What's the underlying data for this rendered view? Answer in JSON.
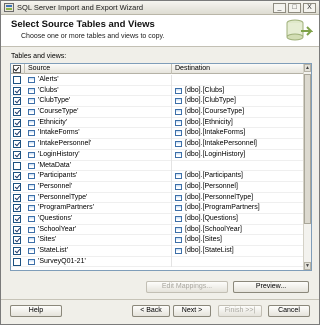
{
  "window": {
    "title": "SQL Server Import and Export Wizard",
    "minimize": "_",
    "maximize": "□",
    "close": "X"
  },
  "header": {
    "title": "Select Source Tables and Views",
    "subtitle": "Choose one or more tables and views to copy."
  },
  "grid": {
    "label": "Tables and views:",
    "columns": {
      "source": "Source",
      "destination": "Destination"
    },
    "header_checked": true,
    "rows": [
      {
        "checked": false,
        "source": "'Alerts'",
        "destination": ""
      },
      {
        "checked": true,
        "source": "'Clubs'",
        "destination": "[dbo].[Clubs]"
      },
      {
        "checked": true,
        "source": "'ClubType'",
        "destination": "[dbo].[ClubType]"
      },
      {
        "checked": true,
        "source": "'CourseType'",
        "destination": "[dbo].[CourseType]"
      },
      {
        "checked": true,
        "source": "'Ethnicity'",
        "destination": "[dbo].[Ethnicity]"
      },
      {
        "checked": true,
        "source": "'IntakeForms'",
        "destination": "[dbo].[IntakeForms]"
      },
      {
        "checked": true,
        "source": "'IntakePersonnel'",
        "destination": "[dbo].[IntakePersonnel]"
      },
      {
        "checked": true,
        "source": "'LoginHistory'",
        "destination": "[dbo].[LoginHistory]"
      },
      {
        "checked": false,
        "source": "'MetaData'",
        "destination": ""
      },
      {
        "checked": true,
        "source": "'Participants'",
        "destination": "[dbo].[Participants]"
      },
      {
        "checked": true,
        "source": "'Personnel'",
        "destination": "[dbo].[Personnel]"
      },
      {
        "checked": true,
        "source": "'PersonnelType'",
        "destination": "[dbo].[PersonnelType]"
      },
      {
        "checked": true,
        "source": "'ProgramPartners'",
        "destination": "[dbo].[ProgramPartners]"
      },
      {
        "checked": true,
        "source": "'Questions'",
        "destination": "[dbo].[Questions]"
      },
      {
        "checked": true,
        "source": "'SchoolYear'",
        "destination": "[dbo].[SchoolYear]"
      },
      {
        "checked": true,
        "source": "'Sites'",
        "destination": "[dbo].[Sites]"
      },
      {
        "checked": true,
        "source": "'StateList'",
        "destination": "[dbo].[StateList]"
      },
      {
        "checked": false,
        "source": "'SurveyQ01-21'",
        "destination": ""
      }
    ]
  },
  "buttons": {
    "edit_mappings": "Edit Mappings...",
    "preview": "Preview...",
    "help": "Help",
    "back": "< Back",
    "next": "Next >",
    "finish": "Finish >>|",
    "cancel": "Cancel"
  },
  "icons": {
    "window": "wizard-icon",
    "table": "table-icon",
    "header_art": "database-wizard-icon"
  }
}
